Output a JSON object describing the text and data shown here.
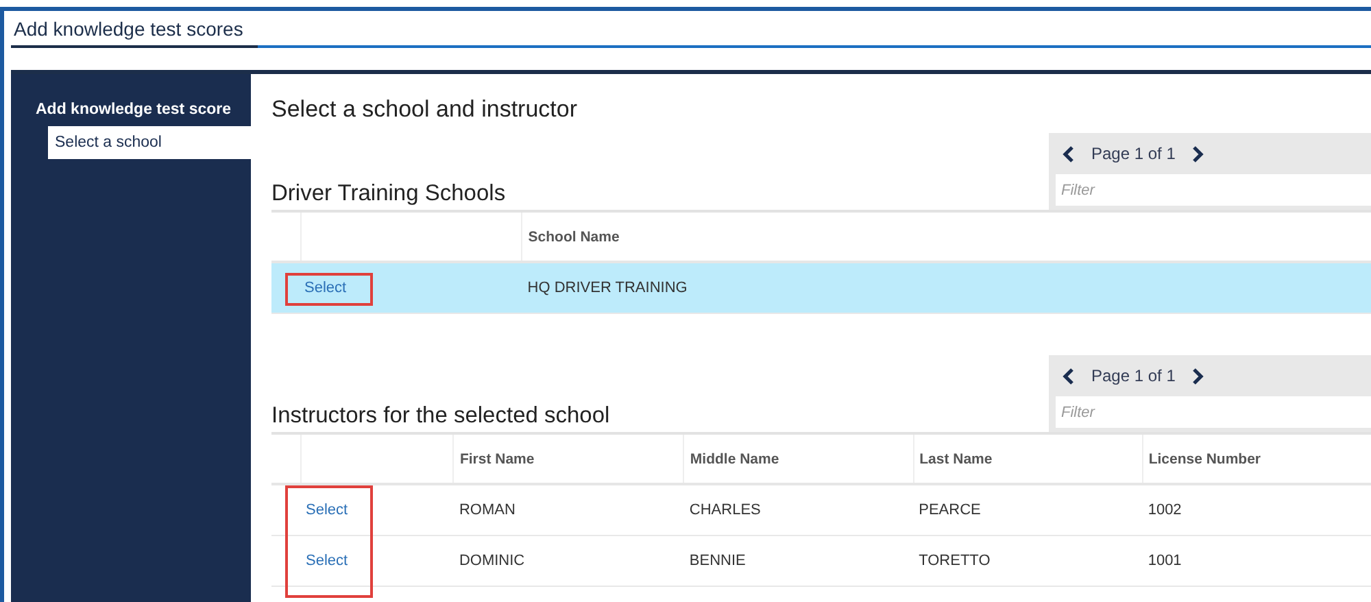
{
  "window": {
    "title": "Add knowledge test scores"
  },
  "sidebar": {
    "title": "Add knowledge test score",
    "items": [
      {
        "label": "Select a school",
        "selected": true
      }
    ]
  },
  "page_title": "Select a school and instructor",
  "sections": [
    {
      "title": "Driver Training Schools",
      "pager": {
        "text": "Page 1 of 1",
        "filter_placeholder": "Filter"
      },
      "highlighted": true,
      "columns": [
        "School Name"
      ],
      "rows": [
        {
          "action": "Select",
          "selected": true,
          "cells": [
            "HQ DRIVER TRAINING"
          ]
        }
      ]
    },
    {
      "title": "Instructors for the selected school",
      "pager": {
        "text": "Page 1 of 1",
        "filter_placeholder": "Filter"
      },
      "highlighted": true,
      "columns": [
        "First Name",
        "Middle Name",
        "Last Name",
        "License Number"
      ],
      "rows": [
        {
          "action": "Select",
          "selected": false,
          "cells": [
            "ROMAN",
            "CHARLES",
            "PEARCE",
            "1002"
          ]
        },
        {
          "action": "Select",
          "selected": false,
          "cells": [
            "DOMINIC",
            "BENNIE",
            "TORETTO",
            "1001"
          ]
        }
      ]
    }
  ]
}
